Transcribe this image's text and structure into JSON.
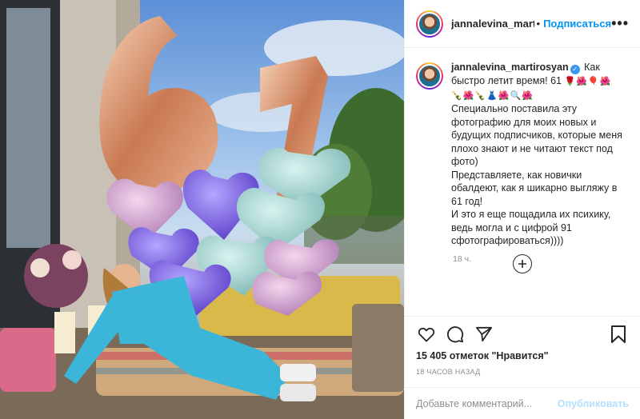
{
  "post": {
    "username": "jannalevina_martirosyan",
    "header_username": "jannalevina_martir",
    "separator": "•",
    "follow_label": "Подписаться",
    "more_label": "•••",
    "caption": {
      "lead": "Как быстро летит время! 61",
      "emoji_line1": "🌹🌺🎈🌺",
      "emoji_line2": "🍾🌺🍾👗🌺🔍🌺",
      "body": "Специально поставила эту фотографию для моих новых и будущих подписчиков, которые меня плохо знают и не читают текст под фото)",
      "body2": "Представляете, как новички обалдеют, как я шикарно выгляжу в 61 год!",
      "body3": "И это я еще пощадила их психику, ведь могла и с цифрой 91 сфотографироваться))))"
    },
    "caption_time": "18 ч.",
    "likes": "15 405 отметок \"Нравится\"",
    "posted_ago": "18 ЧАСОВ НАЗАД",
    "comment_placeholder": "Добавьте комментарий...",
    "publish_label": "Опубликовать",
    "photo": {
      "balloon_text": "61"
    }
  },
  "icons": [
    "heart-icon",
    "comment-icon",
    "share-icon",
    "bookmark-icon",
    "plus-circle-icon",
    "verified-icon"
  ],
  "colors": {
    "accent": "#0095f6",
    "publish_disabled": "#b2dffc",
    "verified": "#3897f0",
    "muted": "#8e8e8e"
  }
}
